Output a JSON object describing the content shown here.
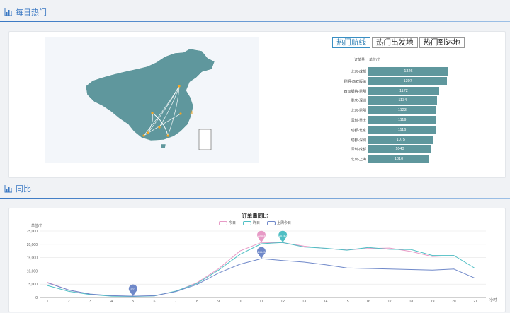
{
  "sections": {
    "daily": {
      "title": "每日热门"
    },
    "compare": {
      "title": "同比"
    }
  },
  "route_panel": {
    "tabs": [
      {
        "label": "热门航线",
        "active": true
      },
      {
        "label": "热门出发地",
        "active": false
      },
      {
        "label": "热门到达地",
        "active": false
      }
    ],
    "header_count": "订单量",
    "header_unit": "单位/个",
    "routes": [
      {
        "label": "北京-成都",
        "value": 1326
      },
      {
        "label": "昆明-西双版纳",
        "value": 1307
      },
      {
        "label": "西双版纳-昆明",
        "value": 1172
      },
      {
        "label": "重庆-深圳",
        "value": 1134
      },
      {
        "label": "北京-昆明",
        "value": 1123
      },
      {
        "label": "深圳-重庆",
        "value": 1119
      },
      {
        "label": "成都-北京",
        "value": 1116
      },
      {
        "label": "成都-深圳",
        "value": 1075
      },
      {
        "label": "深圳-成都",
        "value": 1043
      },
      {
        "label": "北京-上海",
        "value": 1010
      }
    ]
  },
  "map": {
    "fill": "#5f979d",
    "line_color": "#ffffff",
    "label_color": "#f5a623",
    "city_label": "上海"
  },
  "chart_data": {
    "type": "line",
    "title": "订单量同比",
    "ylabel": "单位/个",
    "xlabel": "/小时",
    "x": [
      1,
      2,
      3,
      4,
      5,
      6,
      7,
      8,
      9,
      10,
      11,
      12,
      13,
      14,
      15,
      16,
      17,
      18,
      19,
      20,
      21
    ],
    "ylim": [
      0,
      25000
    ],
    "yticks": [
      "0",
      "5,000",
      "10,000",
      "15,000",
      "20,000",
      "25,000"
    ],
    "series": [
      {
        "name": "今日",
        "color": "#e79ac6",
        "values": [
          5700,
          2800,
          1200,
          600,
          500,
          600,
          2300,
          5600,
          10800,
          17500,
          20700,
          20600,
          19300,
          18400,
          17900,
          18400,
          18600,
          17300,
          15400,
          15800,
          null
        ]
      },
      {
        "name": "昨日",
        "color": "#4fbfc4",
        "values": [
          4500,
          2300,
          1100,
          500,
          400,
          600,
          2400,
          5300,
          10300,
          16200,
          20200,
          20700,
          19000,
          18500,
          17800,
          18800,
          18100,
          18000,
          15800,
          15800,
          10900
        ]
      },
      {
        "name": "上周今日",
        "color": "#6f88c9",
        "values": [
          5500,
          2800,
          1300,
          700,
          500,
          700,
          2200,
          4900,
          9200,
          12500,
          14600,
          13900,
          13300,
          12300,
          11100,
          10900,
          10700,
          10500,
          10300,
          10700,
          7200
        ]
      }
    ],
    "markers": [
      {
        "series": 0,
        "x": 11,
        "label": "20684"
      },
      {
        "series": 1,
        "x": 12,
        "label": "20740"
      },
      {
        "series": 2,
        "x": 11,
        "label": "14645"
      },
      {
        "series": 2,
        "x": 5,
        "label": "527"
      }
    ]
  }
}
